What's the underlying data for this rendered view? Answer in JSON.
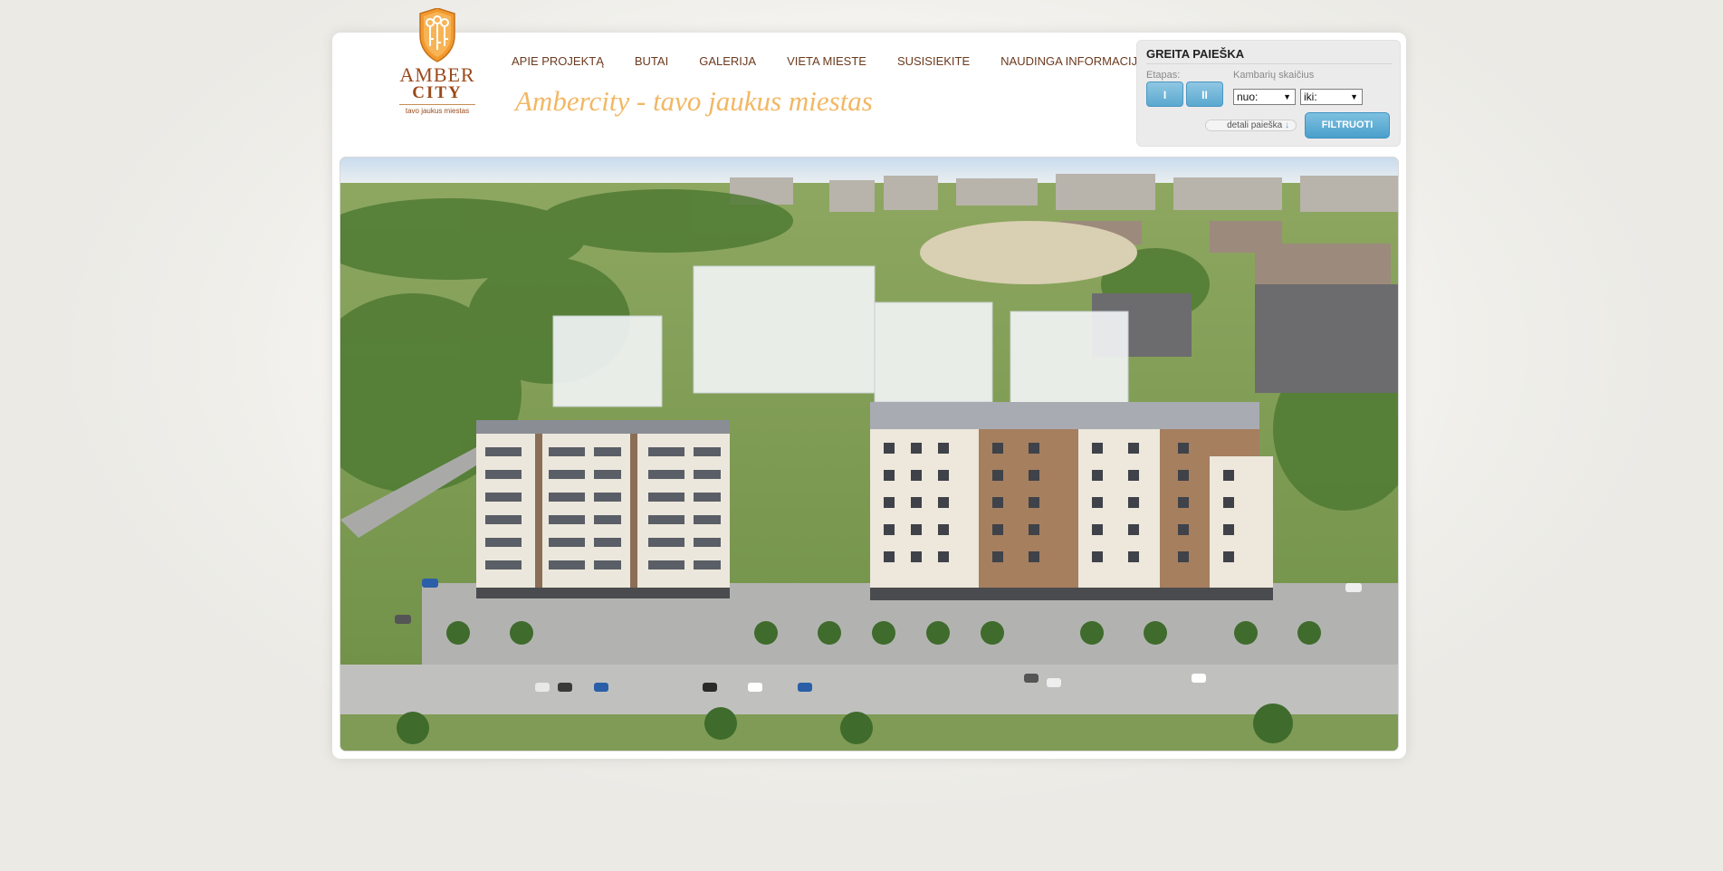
{
  "logo": {
    "word1": "AMBER",
    "word2": "CITY",
    "tagline": "tavo jaukus miestas",
    "icon": "keys-shield-icon"
  },
  "nav": {
    "items": [
      {
        "label": "APIE PROJEKTĄ"
      },
      {
        "label": "BUTAI"
      },
      {
        "label": "GALERIJA"
      },
      {
        "label": "VIETA MIESTE"
      },
      {
        "label": "SUSISIEKITE"
      },
      {
        "label": "NAUDINGA INFORMACIJA"
      }
    ]
  },
  "header": {
    "tagline": "Ambercity - tavo jaukus miestas"
  },
  "search": {
    "title": "GREITA PAIEŠKA",
    "stage_label": "Etapas:",
    "stages": [
      "I",
      "II"
    ],
    "rooms_label": "Kambarių skaičius",
    "from_value": "nuo:",
    "to_value": "iki:",
    "detail_link": "detali paieška",
    "detail_icon": "arrow-down-icon",
    "filter_button": "FILTRUOTI"
  },
  "hero": {
    "image": "aerial-render-of-apartment-complex"
  },
  "colors": {
    "accent_orange": "#f2b763",
    "nav_brown": "#6b3a1e",
    "button_blue": "#5aa8d0"
  }
}
